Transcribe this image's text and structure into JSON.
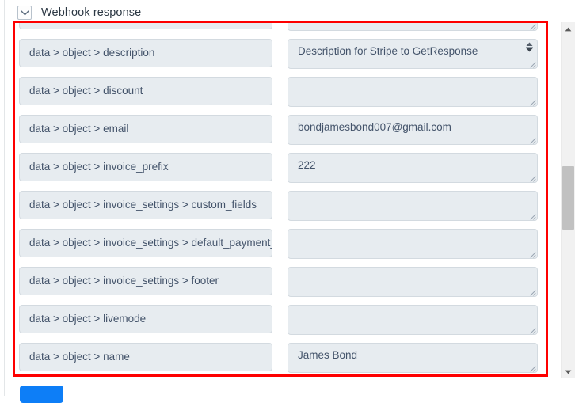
{
  "header": {
    "title": "Webhook response",
    "toggle_icon": "chevron-down-icon"
  },
  "mapping": {
    "rows": [
      {
        "path": "",
        "value": "",
        "partial": true,
        "has_spinner": false
      },
      {
        "path": "data > object > description",
        "value": "Description for Stripe to GetResponse",
        "partial": false,
        "has_spinner": true
      },
      {
        "path": "data > object > discount",
        "value": "",
        "partial": false,
        "has_spinner": false
      },
      {
        "path": "data > object > email",
        "value": "bondjamesbond007@gmail.com",
        "partial": false,
        "has_spinner": false
      },
      {
        "path": "data > object > invoice_prefix",
        "value": "222",
        "partial": false,
        "has_spinner": false
      },
      {
        "path": "data > object > invoice_settings > custom_fields",
        "value": "",
        "partial": false,
        "has_spinner": false
      },
      {
        "path": "data > object > invoice_settings > default_payment_method",
        "value": "",
        "partial": false,
        "has_spinner": false
      },
      {
        "path": "data > object > invoice_settings > footer",
        "value": "",
        "partial": false,
        "has_spinner": false
      },
      {
        "path": "data > object > livemode",
        "value": "",
        "partial": false,
        "has_spinner": false
      },
      {
        "path": "data > object > name",
        "value": "James Bond",
        "partial": false,
        "has_spinner": false
      }
    ]
  },
  "scrollbar": {
    "up_icon": "triangle-up-icon",
    "down_icon": "triangle-down-icon"
  },
  "footer": {
    "submit_label": ""
  },
  "colors": {
    "annotation": "#fe0000",
    "field_background": "#e7ecf0",
    "field_border": "#d3dae0",
    "text": "#43536a",
    "button": "#0d7ef7",
    "scrollbar_thumb": "#c1c1c1"
  }
}
